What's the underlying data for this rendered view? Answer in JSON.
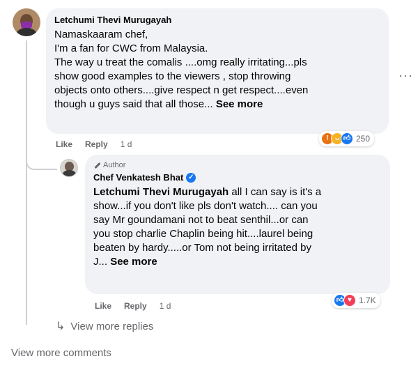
{
  "comment": {
    "author": "Letchumi Thevi Murugayah",
    "lines": [
      "Namaskaaram chef,",
      "I'm a fan for CWC from Malaysia.",
      "The way u treat the comalis ....omg really irritating...pls",
      "show good examples to the viewers , stop throwing",
      "objects onto others....give respect n get respect....even",
      "though u guys said that all those..."
    ],
    "see_more": "See more",
    "actions": {
      "like": "Like",
      "reply": "Reply",
      "time": "1 d"
    },
    "reactions": {
      "icons": [
        "angry-icon",
        "haha-icon",
        "like-icon"
      ],
      "count": "250"
    }
  },
  "reply": {
    "badge": "Author",
    "author": "Chef Venkatesh Bhat",
    "tagged": "Letchumi Thevi Murugayah",
    "first_line_rest": " all I can say is it's a",
    "lines": [
      "show...if you don't like pls don't watch.... can you",
      "say Mr goundamani not to beat senthil...or can",
      "you stop charlie Chaplin being hit....laurel being",
      "beaten by hardy.....or Tom not being irritated by"
    ],
    "last_line": "J...",
    "see_more": "See more",
    "actions": {
      "like": "Like",
      "reply": "Reply",
      "time": "1 d"
    },
    "reactions": {
      "icons": [
        "like-icon",
        "love-icon"
      ],
      "count": "1.7K"
    }
  },
  "view_more_replies": "View more replies",
  "view_more_comments": "View more comments",
  "colors": {
    "bubble": "#f0f2f5",
    "muted": "#65676b",
    "accent": "#1877f2"
  }
}
